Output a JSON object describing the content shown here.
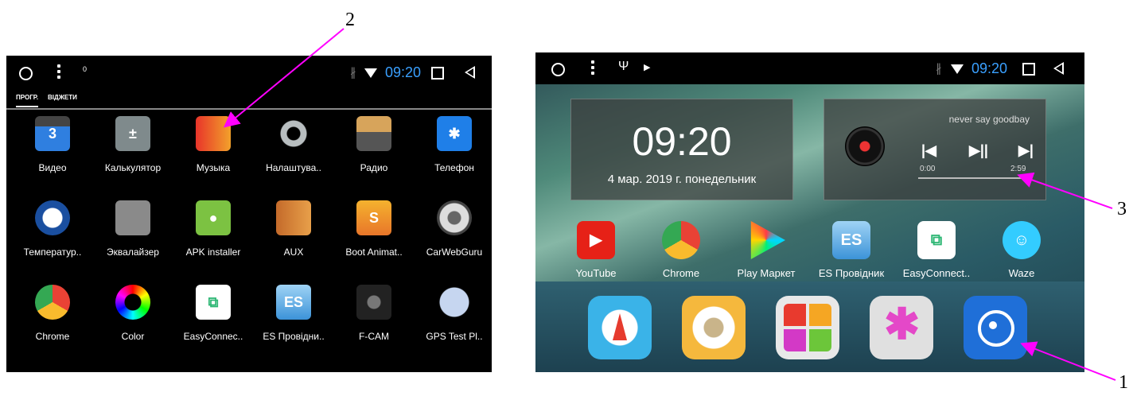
{
  "callouts": {
    "one": "1",
    "two": "2",
    "three": "3"
  },
  "left": {
    "status": {
      "indicator": "0",
      "time": "09:20"
    },
    "tabs": [
      "ПРОГР.",
      "ВІДЖЕТИ"
    ],
    "apps": [
      {
        "label": "Видео",
        "icon": "video-icon"
      },
      {
        "label": "Калькулятор",
        "icon": "calculator-icon"
      },
      {
        "label": "Музыка",
        "icon": "music-microphone-icon"
      },
      {
        "label": "Налаштува..",
        "icon": "settings-gear-icon"
      },
      {
        "label": "Радио",
        "icon": "radio-icon"
      },
      {
        "label": "Телефон",
        "icon": "bluetooth-phone-icon"
      },
      {
        "label": "Температур..",
        "icon": "temperature-chip-icon"
      },
      {
        "label": "Эквалайзер",
        "icon": "equalizer-icon"
      },
      {
        "label": "APK installer",
        "icon": "android-icon"
      },
      {
        "label": "AUX",
        "icon": "aux-sliders-icon"
      },
      {
        "label": "Boot Animat..",
        "icon": "boot-animation-icon"
      },
      {
        "label": "CarWebGuru",
        "icon": "steering-wheel-icon"
      },
      {
        "label": "Chrome",
        "icon": "chrome-icon"
      },
      {
        "label": "Color",
        "icon": "color-wheel-icon"
      },
      {
        "label": "EasyConnec..",
        "icon": "easyconnect-icon"
      },
      {
        "label": "ES Провідни..",
        "icon": "es-explorer-icon"
      },
      {
        "label": "F-CAM",
        "icon": "camera-icon"
      },
      {
        "label": "GPS Test Pl..",
        "icon": "gps-globe-icon"
      }
    ]
  },
  "right": {
    "status": {
      "time": "09:20"
    },
    "clock": {
      "time": "09:20",
      "date": "4 мар. 2019 г.  понедельник"
    },
    "player": {
      "song": "never say goodbay",
      "elapsed": "0:00",
      "duration": "2:59"
    },
    "apps": [
      {
        "label": "YouTube",
        "icon": "youtube-icon"
      },
      {
        "label": "Chrome",
        "icon": "chrome-icon"
      },
      {
        "label": "Play Маркет",
        "icon": "play-store-icon"
      },
      {
        "label": "ES Провідник",
        "icon": "es-explorer-icon"
      },
      {
        "label": "EasyConnect..",
        "icon": "easyconnect-icon"
      },
      {
        "label": "Waze",
        "icon": "waze-icon"
      }
    ],
    "dock": [
      "navigation-compass-icon",
      "radio-dial-icon",
      "apps-grid-icon",
      "bluetooth-icon",
      "video-player-icon"
    ]
  }
}
